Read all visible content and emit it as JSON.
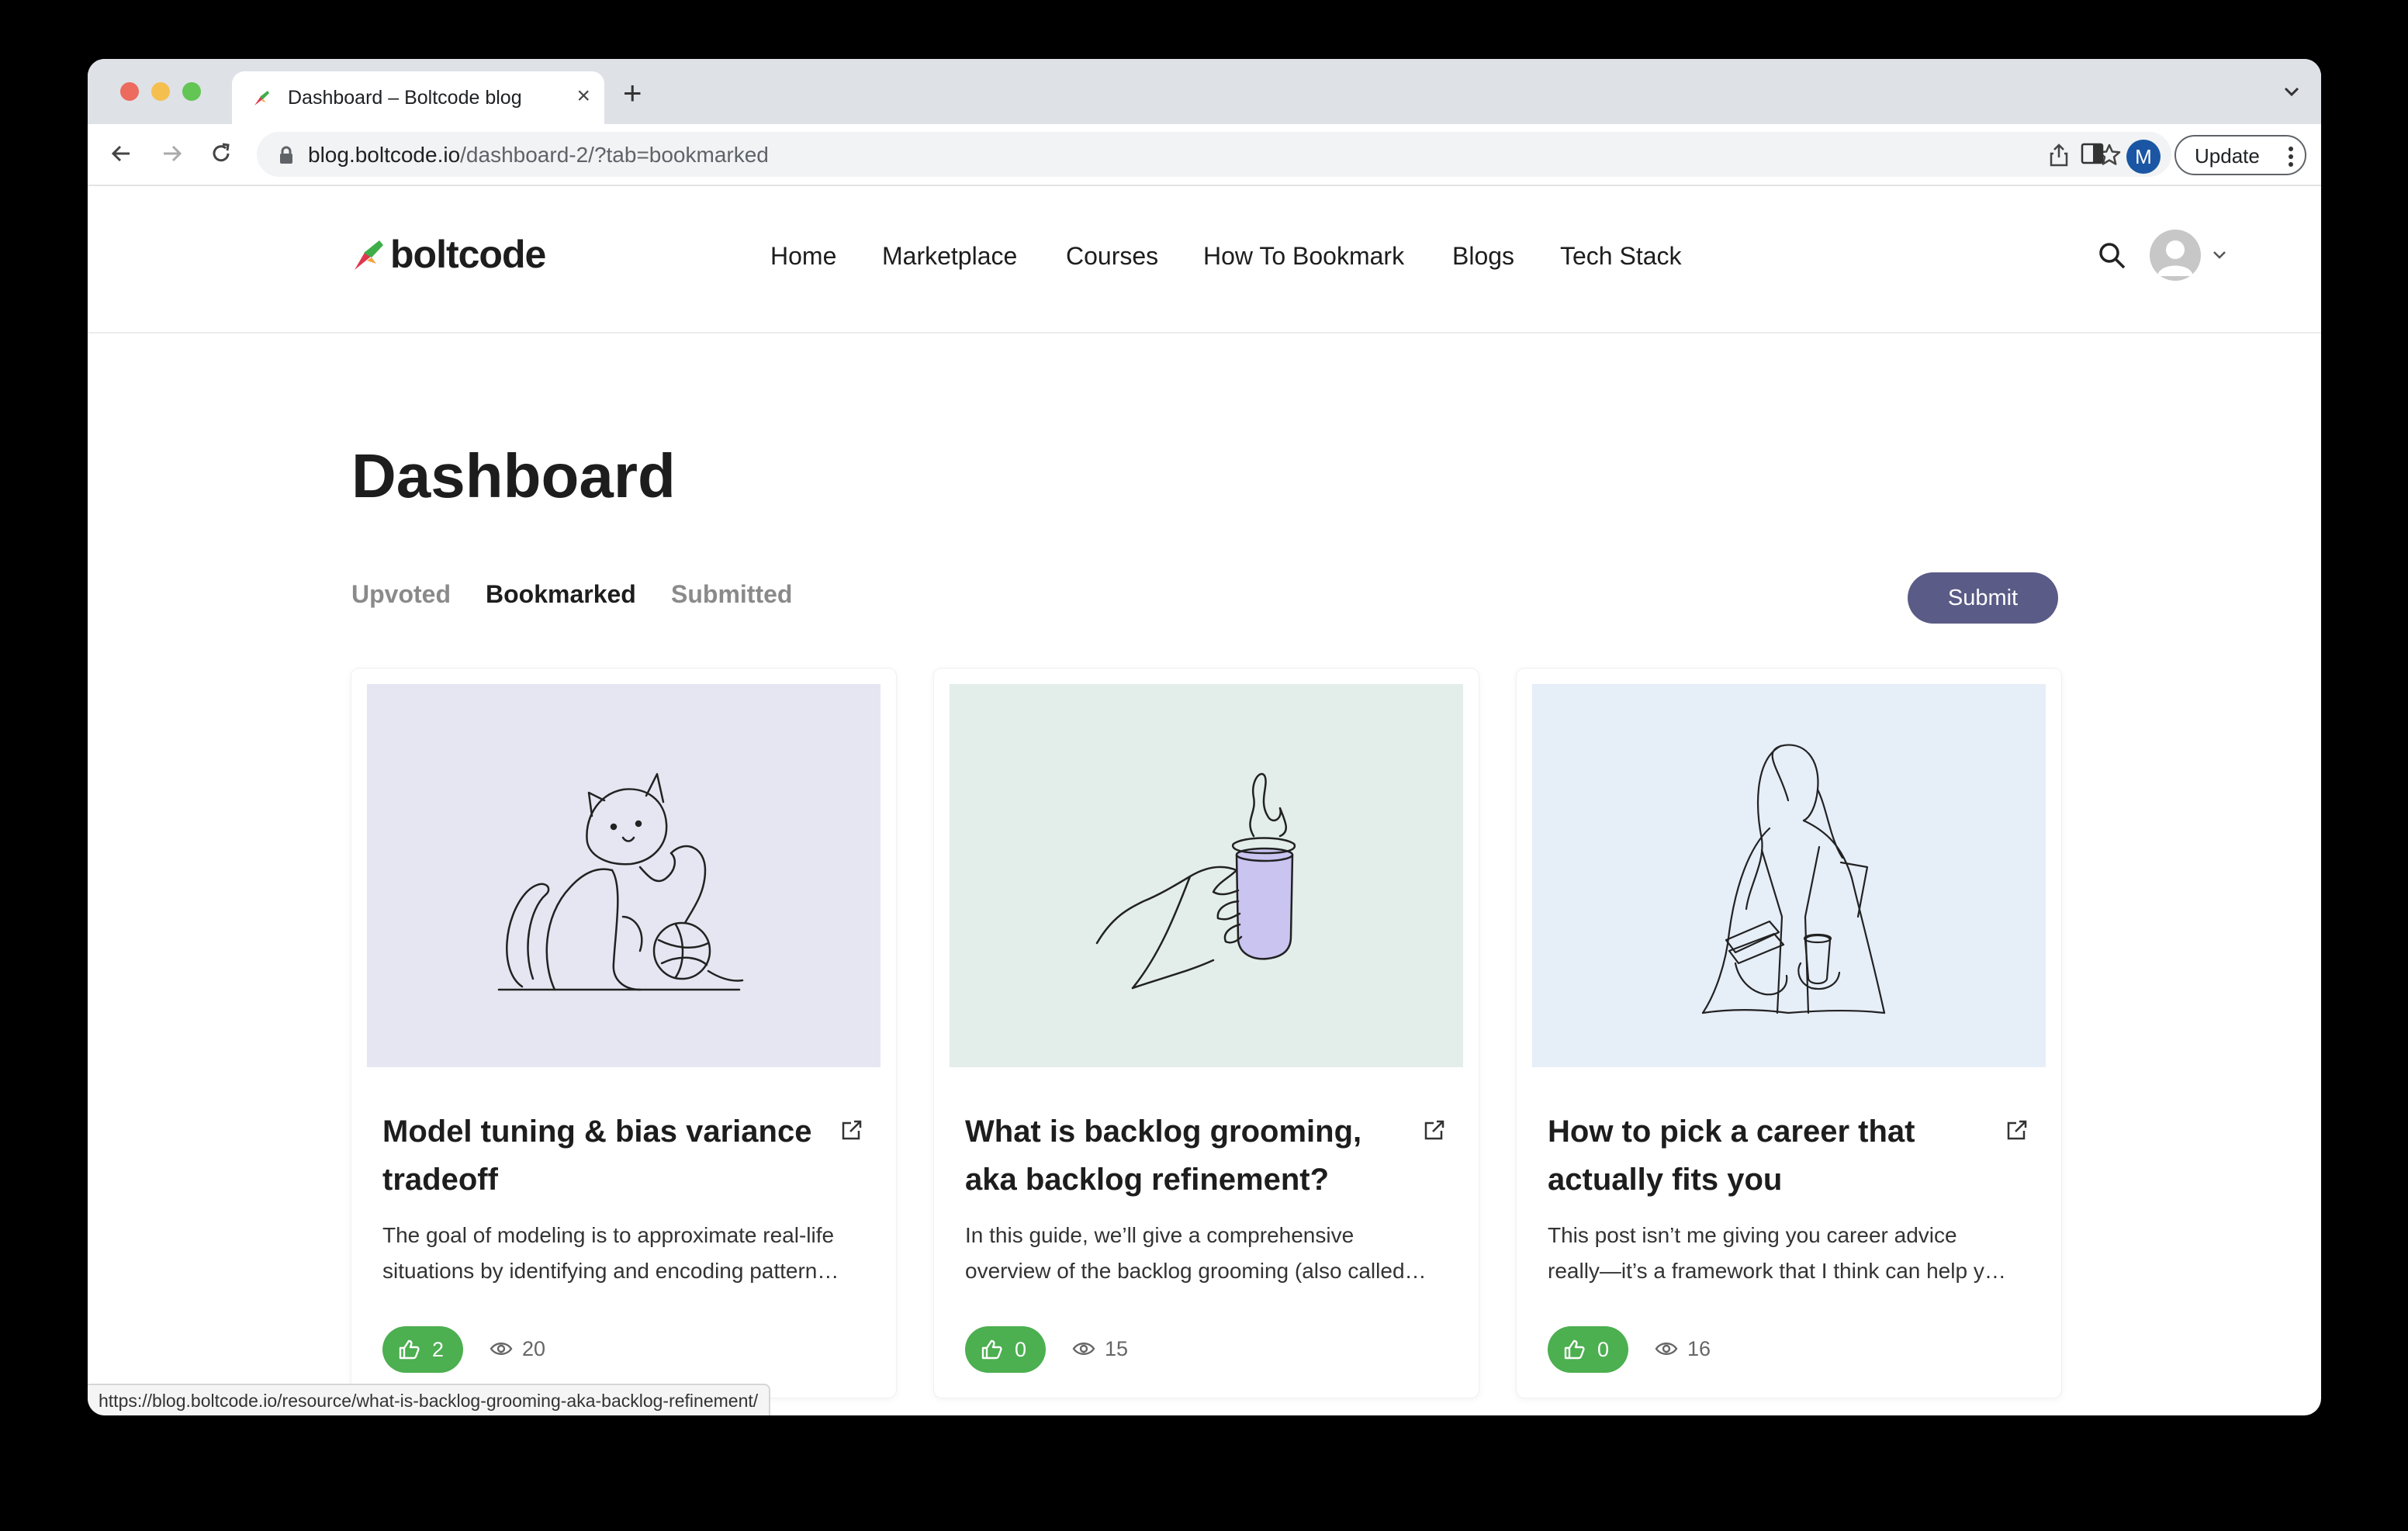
{
  "browser": {
    "tab_title": "Dashboard – Boltcode blog",
    "url_domain": "blog.boltcode.io",
    "url_path": "/dashboard-2/?tab=bookmarked",
    "profile_initial": "M",
    "update_label": "Update",
    "status_url": "https://blog.boltcode.io/resource/what-is-backlog-grooming-aka-backlog-refinement/"
  },
  "site": {
    "logo_text": "boltcode",
    "nav": [
      "Home",
      "Marketplace",
      "Courses",
      "How To Bookmark",
      "Blogs",
      "Tech Stack"
    ]
  },
  "dashboard": {
    "title": "Dashboard",
    "tabs": [
      {
        "label": "Upvoted",
        "active": false
      },
      {
        "label": "Bookmarked",
        "active": true
      },
      {
        "label": "Submitted",
        "active": false
      }
    ],
    "submit_label": "Submit"
  },
  "cards": [
    {
      "title": "Model tuning & bias variance tradeoff",
      "desc_line1": "The goal of modeling is to approximate real-life",
      "desc_line2": "situations by identifying and encoding pattern…",
      "upvotes": "2",
      "views": "20",
      "image": "cat-with-yarn-illustration",
      "bg": "#e6e6f3"
    },
    {
      "title": "What is backlog grooming, aka backlog refinement?",
      "desc_line1": "In this guide, we’ll give a comprehensive",
      "desc_line2": "overview of the backlog grooming (also called…",
      "upvotes": "0",
      "views": "15",
      "image": "hand-holding-coffee-mug-illustration",
      "bg": "#e3eeea"
    },
    {
      "title": "How to pick a career that actually fits you",
      "desc_line1": "This post isn’t me giving you career advice",
      "desc_line2": "really—it’s a framework that I think can help y…",
      "upvotes": "0",
      "views": "16",
      "image": "woman-with-books-and-coffee-illustration",
      "bg": "#e6eef8"
    }
  ],
  "colors": {
    "submit": "#5b5b87",
    "upvote": "#4caf50",
    "mug": "#c9c4f0"
  }
}
